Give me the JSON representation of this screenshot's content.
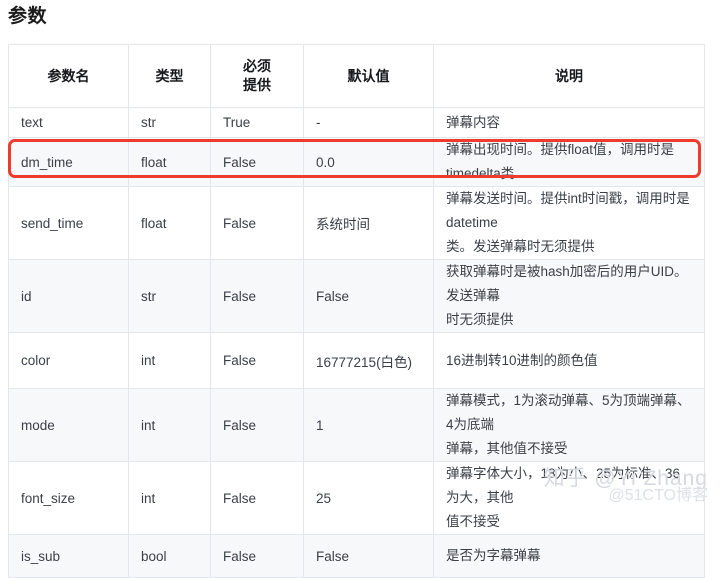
{
  "page": {
    "title": "参数"
  },
  "table": {
    "headers": [
      "参数名",
      "类型",
      "必须\n提供",
      "默认值",
      "说明"
    ],
    "headers_flat": {
      "name": "参数名",
      "type": "类型",
      "required_line1": "必须",
      "required_line2": "提供",
      "default": "默认值",
      "description": "说明"
    },
    "rows": [
      {
        "name": "text",
        "type": "str",
        "required": "True",
        "default": "-",
        "desc_line1": "弹幕内容",
        "desc_line2": ""
      },
      {
        "name": "dm_time",
        "type": "float",
        "required": "False",
        "default": "0.0",
        "desc_line1": "弹幕出现时间。提供float值，调用时是timedelta类",
        "desc_line2": ""
      },
      {
        "name": "send_time",
        "type": "float",
        "required": "False",
        "default": "系统时间",
        "desc_line1": "弹幕发送时间。提供int时间戳，调用时是datetime",
        "desc_line2": "类。发送弹幕时无须提供"
      },
      {
        "name": "id",
        "type": "str",
        "required": "False",
        "default": "False",
        "desc_line1": "获取弹幕时是被hash加密后的用户UID。发送弹幕",
        "desc_line2": "时无须提供"
      },
      {
        "name": "color",
        "type": "int",
        "required": "False",
        "default": "16777215(白色)",
        "desc_line1": "16进制转10进制的颜色值",
        "desc_line2": ""
      },
      {
        "name": "mode",
        "type": "int",
        "required": "False",
        "default": "1",
        "desc_line1": "弹幕模式，1为滚动弹幕、5为顶端弹幕、4为底端",
        "desc_line2": "弹幕，其他值不接受"
      },
      {
        "name": "font_size",
        "type": "int",
        "required": "False",
        "default": "25",
        "desc_line1": "弹幕字体大小，18为小、25为标准、36为大，其他",
        "desc_line2": "值不接受"
      },
      {
        "name": "is_sub",
        "type": "bool",
        "required": "False",
        "default": "False",
        "desc_line1": "是否为字幕弹幕",
        "desc_line2": ""
      }
    ]
  },
  "highlight": {
    "target_row": "dm_time",
    "color": "#ef3b2d"
  },
  "watermark": {
    "line1": "知乎 @Yi Zhang",
    "line2": "@51CTO博客"
  },
  "colors": {
    "border": "#e3e6eb",
    "row_alt": "#f7f8fa",
    "text": "#3a3f47",
    "heading": "#17181c",
    "highlight": "#ef3b2d"
  }
}
